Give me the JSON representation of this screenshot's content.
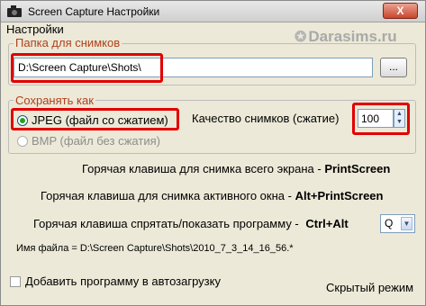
{
  "window": {
    "title": "Screen Capture Настройки",
    "close_label": "X",
    "panel_label": "Настройки",
    "watermark": "Darasims.ru",
    "watermark_star": "✪"
  },
  "folder": {
    "legend": "Папка для снимков",
    "path_value": "D:\\Screen Capture\\Shots\\",
    "browse_label": "..."
  },
  "save_as": {
    "legend": "Сохранять как",
    "options": [
      {
        "label": "JPEG (файл со сжатием)",
        "selected": true
      },
      {
        "label": "BMP (файл без сжатия)",
        "selected": false
      }
    ],
    "quality_label": "Качество снимков (сжатие)",
    "quality_value": "100"
  },
  "hotkeys": {
    "fullscreen_label": "Горячая клавиша для снимка всего экрана -",
    "fullscreen_key": "PrintScreen",
    "active_window_label": "Горячая клавиша для снимка активного окна -",
    "active_window_key": "Alt+PrintScreen",
    "toggle_label": "Горячая клавиша спрятать/показать программу -",
    "toggle_key": "Ctrl+Alt",
    "toggle_select_value": "Q"
  },
  "filename_preview": "Имя файла = D:\\Screen Capture\\Shots\\2010_7_3_14_16_56.*",
  "autostart_label": "Добавить программу в автозагрузку",
  "hidden_mode_label": "Скрытый режим",
  "colors": {
    "highlight": "#e10000",
    "legend_text": "#b0401a",
    "window_bg": "#ece9d8"
  }
}
